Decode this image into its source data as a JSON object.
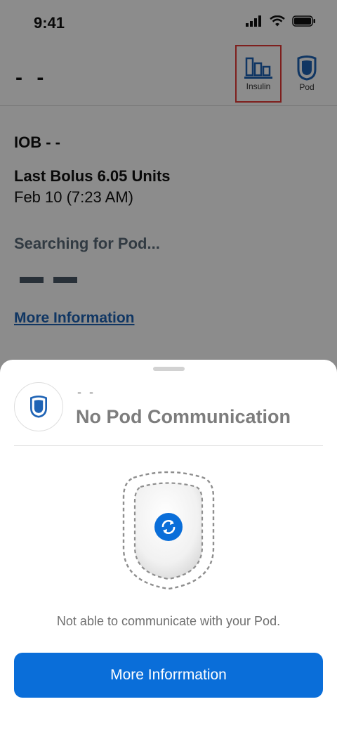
{
  "status_bar": {
    "time": "9:41"
  },
  "header": {
    "title": "- -",
    "insulin_label": "Insulin",
    "pod_label": "Pod"
  },
  "main": {
    "iob": "IOB - -",
    "last_bolus": "Last Bolus 6.05 Units",
    "bolus_date": "Feb 10 (7:23 AM)",
    "searching": "Searching for Pod...",
    "more_info_link": "More Information"
  },
  "sheet": {
    "dashes": "- -",
    "title": "No Pod Communication",
    "message": "Not able to communicate with your Pod.",
    "button_label": "More Inforrmation"
  },
  "icons": {
    "insulin": "insulin-bars-icon",
    "pod": "pod-shield-icon",
    "sync": "sync-arrows-icon"
  },
  "colors": {
    "accent": "#0a6ed9",
    "link": "#1e63b5",
    "highlight": "#e53935"
  }
}
